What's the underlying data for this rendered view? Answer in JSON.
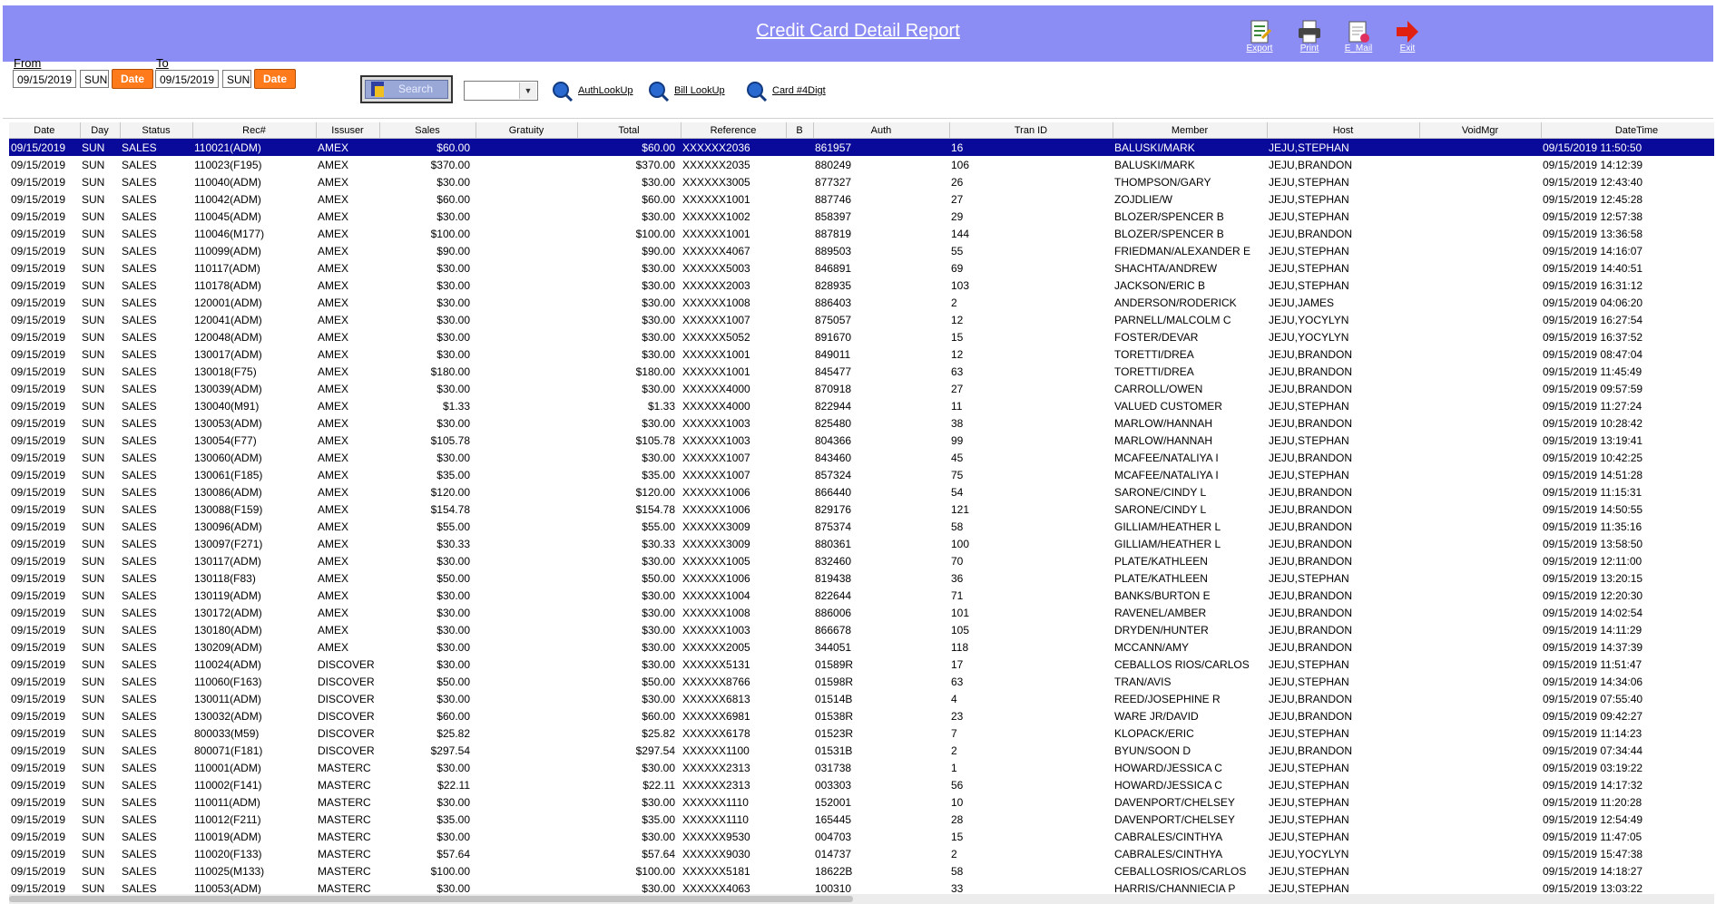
{
  "header": {
    "title": "Credit Card Detail Report",
    "buttons": {
      "export": "Export",
      "print": "Print",
      "email": "E_Mail",
      "exit": "Exit"
    }
  },
  "toolbar": {
    "from_label": "From",
    "from_date": "09/15/2019",
    "from_day": "SUN",
    "from_date_button": "Date",
    "to_label": "To",
    "to_date": "09/15/2019",
    "to_day": "SUN",
    "to_date_button": "Date",
    "search_label": "Search",
    "filter_value": "",
    "auth_lookup": "AuthLookUp",
    "bill_lookup": "Bill LookUp",
    "card_lookup": "Card #4Digt"
  },
  "columns": [
    "Date",
    "Day",
    "Status",
    "Rec#",
    "Issuser",
    "Sales",
    "Gratuity",
    "Total",
    "Reference",
    "B",
    "Auth",
    "Tran ID",
    "Member",
    "Host",
    "VoidMgr",
    "DateTime"
  ],
  "rows": [
    [
      "09/15/2019",
      "SUN",
      "SALES",
      "110021(ADM)",
      "AMEX",
      "$60.00",
      "",
      "$60.00",
      "XXXXXX2036",
      "",
      "861957",
      "16",
      "BALUSKI/MARK",
      "JEJU,STEPHAN",
      "",
      "09/15/2019 11:50:50"
    ],
    [
      "09/15/2019",
      "SUN",
      "SALES",
      "110023(F195)",
      "AMEX",
      "$370.00",
      "",
      "$370.00",
      "XXXXXX2035",
      "",
      "880249",
      "106",
      "BALUSKI/MARK",
      "JEJU,BRANDON",
      "",
      "09/15/2019 14:12:39"
    ],
    [
      "09/15/2019",
      "SUN",
      "SALES",
      "110040(ADM)",
      "AMEX",
      "$30.00",
      "",
      "$30.00",
      "XXXXXX3005",
      "",
      "877327",
      "26",
      "THOMPSON/GARY",
      "JEJU,STEPHAN",
      "",
      "09/15/2019 12:43:40"
    ],
    [
      "09/15/2019",
      "SUN",
      "SALES",
      "110042(ADM)",
      "AMEX",
      "$60.00",
      "",
      "$60.00",
      "XXXXXX1001",
      "",
      "887746",
      "27",
      "ZOJDLIE/W",
      "JEJU,STEPHAN",
      "",
      "09/15/2019 12:45:28"
    ],
    [
      "09/15/2019",
      "SUN",
      "SALES",
      "110045(ADM)",
      "AMEX",
      "$30.00",
      "",
      "$30.00",
      "XXXXXX1002",
      "",
      "858397",
      "29",
      "BLOZER/SPENCER B",
      "JEJU,STEPHAN",
      "",
      "09/15/2019 12:57:38"
    ],
    [
      "09/15/2019",
      "SUN",
      "SALES",
      "110046(M177)",
      "AMEX",
      "$100.00",
      "",
      "$100.00",
      "XXXXXX1001",
      "",
      "887819",
      "144",
      "BLOZER/SPENCER B",
      "JEJU,BRANDON",
      "",
      "09/15/2019 13:36:58"
    ],
    [
      "09/15/2019",
      "SUN",
      "SALES",
      "110099(ADM)",
      "AMEX",
      "$90.00",
      "",
      "$90.00",
      "XXXXXX4067",
      "",
      "889503",
      "55",
      "FRIEDMAN/ALEXANDER E",
      "JEJU,STEPHAN",
      "",
      "09/15/2019 14:16:07"
    ],
    [
      "09/15/2019",
      "SUN",
      "SALES",
      "110117(ADM)",
      "AMEX",
      "$30.00",
      "",
      "$30.00",
      "XXXXXX5003",
      "",
      "846891",
      "69",
      "SHACHTA/ANDREW",
      "JEJU,STEPHAN",
      "",
      "09/15/2019 14:40:51"
    ],
    [
      "09/15/2019",
      "SUN",
      "SALES",
      "110178(ADM)",
      "AMEX",
      "$30.00",
      "",
      "$30.00",
      "XXXXXX2003",
      "",
      "828935",
      "103",
      "JACKSON/ERIC B",
      "JEJU,STEPHAN",
      "",
      "09/15/2019 16:31:12"
    ],
    [
      "09/15/2019",
      "SUN",
      "SALES",
      "120001(ADM)",
      "AMEX",
      "$30.00",
      "",
      "$30.00",
      "XXXXXX1008",
      "",
      "886403",
      "2",
      "ANDERSON/RODERICK",
      "JEJU,JAMES",
      "",
      "09/15/2019 04:06:20"
    ],
    [
      "09/15/2019",
      "SUN",
      "SALES",
      "120041(ADM)",
      "AMEX",
      "$30.00",
      "",
      "$30.00",
      "XXXXXX1007",
      "",
      "875057",
      "12",
      "PARNELL/MALCOLM C",
      "JEJU,YOCYLYN",
      "",
      "09/15/2019 16:27:54"
    ],
    [
      "09/15/2019",
      "SUN",
      "SALES",
      "120048(ADM)",
      "AMEX",
      "$30.00",
      "",
      "$30.00",
      "XXXXXX5052",
      "",
      "891670",
      "15",
      "FOSTER/DEVAR",
      "JEJU,YOCYLYN",
      "",
      "09/15/2019 16:37:52"
    ],
    [
      "09/15/2019",
      "SUN",
      "SALES",
      "130017(ADM)",
      "AMEX",
      "$30.00",
      "",
      "$30.00",
      "XXXXXX1001",
      "",
      "849011",
      "12",
      "TORETTI/DREA",
      "JEJU,BRANDON",
      "",
      "09/15/2019 08:47:04"
    ],
    [
      "09/15/2019",
      "SUN",
      "SALES",
      "130018(F75)",
      "AMEX",
      "$180.00",
      "",
      "$180.00",
      "XXXXXX1001",
      "",
      "845477",
      "63",
      "TORETTI/DREA",
      "JEJU,BRANDON",
      "",
      "09/15/2019 11:45:49"
    ],
    [
      "09/15/2019",
      "SUN",
      "SALES",
      "130039(ADM)",
      "AMEX",
      "$30.00",
      "",
      "$30.00",
      "XXXXXX4000",
      "",
      "870918",
      "27",
      "CARROLL/OWEN",
      "JEJU,BRANDON",
      "",
      "09/15/2019 09:57:59"
    ],
    [
      "09/15/2019",
      "SUN",
      "SALES",
      "130040(M91)",
      "AMEX",
      "$1.33",
      "",
      "$1.33",
      "XXXXXX4000",
      "",
      "822944",
      "11",
      "VALUED CUSTOMER",
      "JEJU,STEPHAN",
      "",
      "09/15/2019 11:27:24"
    ],
    [
      "09/15/2019",
      "SUN",
      "SALES",
      "130053(ADM)",
      "AMEX",
      "$30.00",
      "",
      "$30.00",
      "XXXXXX1003",
      "",
      "825480",
      "38",
      "MARLOW/HANNAH",
      "JEJU,BRANDON",
      "",
      "09/15/2019 10:28:42"
    ],
    [
      "09/15/2019",
      "SUN",
      "SALES",
      "130054(F77)",
      "AMEX",
      "$105.78",
      "",
      "$105.78",
      "XXXXXX1003",
      "",
      "804366",
      "99",
      "MARLOW/HANNAH",
      "JEJU,STEPHAN",
      "",
      "09/15/2019 13:19:41"
    ],
    [
      "09/15/2019",
      "SUN",
      "SALES",
      "130060(ADM)",
      "AMEX",
      "$30.00",
      "",
      "$30.00",
      "XXXXXX1007",
      "",
      "843460",
      "45",
      "MCAFEE/NATALIYA I",
      "JEJU,BRANDON",
      "",
      "09/15/2019 10:42:25"
    ],
    [
      "09/15/2019",
      "SUN",
      "SALES",
      "130061(F185)",
      "AMEX",
      "$35.00",
      "",
      "$35.00",
      "XXXXXX1007",
      "",
      "857324",
      "75",
      "MCAFEE/NATALIYA I",
      "JEJU,STEPHAN",
      "",
      "09/15/2019 14:51:28"
    ],
    [
      "09/15/2019",
      "SUN",
      "SALES",
      "130086(ADM)",
      "AMEX",
      "$120.00",
      "",
      "$120.00",
      "XXXXXX1006",
      "",
      "866440",
      "54",
      "SARONE/CINDY L",
      "JEJU,BRANDON",
      "",
      "09/15/2019 11:15:31"
    ],
    [
      "09/15/2019",
      "SUN",
      "SALES",
      "130088(F159)",
      "AMEX",
      "$154.78",
      "",
      "$154.78",
      "XXXXXX1006",
      "",
      "829176",
      "121",
      "SARONE/CINDY L",
      "JEJU,BRANDON",
      "",
      "09/15/2019 14:50:55"
    ],
    [
      "09/15/2019",
      "SUN",
      "SALES",
      "130096(ADM)",
      "AMEX",
      "$55.00",
      "",
      "$55.00",
      "XXXXXX3009",
      "",
      "875374",
      "58",
      "GILLIAM/HEATHER L",
      "JEJU,BRANDON",
      "",
      "09/15/2019 11:35:16"
    ],
    [
      "09/15/2019",
      "SUN",
      "SALES",
      "130097(F271)",
      "AMEX",
      "$30.33",
      "",
      "$30.33",
      "XXXXXX3009",
      "",
      "880361",
      "100",
      "GILLIAM/HEATHER L",
      "JEJU,BRANDON",
      "",
      "09/15/2019 13:58:50"
    ],
    [
      "09/15/2019",
      "SUN",
      "SALES",
      "130117(ADM)",
      "AMEX",
      "$30.00",
      "",
      "$30.00",
      "XXXXXX1005",
      "",
      "832460",
      "70",
      "PLATE/KATHLEEN",
      "JEJU,BRANDON",
      "",
      "09/15/2019 12:11:00"
    ],
    [
      "09/15/2019",
      "SUN",
      "SALES",
      "130118(F83)",
      "AMEX",
      "$50.00",
      "",
      "$50.00",
      "XXXXXX1006",
      "",
      "819438",
      "36",
      "PLATE/KATHLEEN",
      "JEJU,STEPHAN",
      "",
      "09/15/2019 13:20:15"
    ],
    [
      "09/15/2019",
      "SUN",
      "SALES",
      "130119(ADM)",
      "AMEX",
      "$30.00",
      "",
      "$30.00",
      "XXXXXX1004",
      "",
      "822644",
      "71",
      "BANKS/BURTON E",
      "JEJU,BRANDON",
      "",
      "09/15/2019 12:20:30"
    ],
    [
      "09/15/2019",
      "SUN",
      "SALES",
      "130172(ADM)",
      "AMEX",
      "$30.00",
      "",
      "$30.00",
      "XXXXXX1008",
      "",
      "886006",
      "101",
      "RAVENEL/AMBER",
      "JEJU,BRANDON",
      "",
      "09/15/2019 14:02:54"
    ],
    [
      "09/15/2019",
      "SUN",
      "SALES",
      "130180(ADM)",
      "AMEX",
      "$30.00",
      "",
      "$30.00",
      "XXXXXX1003",
      "",
      "866678",
      "105",
      "DRYDEN/HUNTER",
      "JEJU,BRANDON",
      "",
      "09/15/2019 14:11:29"
    ],
    [
      "09/15/2019",
      "SUN",
      "SALES",
      "130209(ADM)",
      "AMEX",
      "$30.00",
      "",
      "$30.00",
      "XXXXXX2005",
      "",
      "344051",
      "118",
      "MCCANN/AMY",
      "JEJU,BRANDON",
      "",
      "09/15/2019 14:37:39"
    ],
    [
      "09/15/2019",
      "SUN",
      "SALES",
      "110024(ADM)",
      "DISCOVER",
      "$30.00",
      "",
      "$30.00",
      "XXXXXX5131",
      "",
      "01589R",
      "17",
      "CEBALLOS RIOS/CARLOS",
      "JEJU,STEPHAN",
      "",
      "09/15/2019 11:51:47"
    ],
    [
      "09/15/2019",
      "SUN",
      "SALES",
      "110060(F163)",
      "DISCOVER",
      "$50.00",
      "",
      "$50.00",
      "XXXXXX8766",
      "",
      "01598R",
      "63",
      "TRAN/AVIS",
      "JEJU,STEPHAN",
      "",
      "09/15/2019 14:34:06"
    ],
    [
      "09/15/2019",
      "SUN",
      "SALES",
      "130011(ADM)",
      "DISCOVER",
      "$30.00",
      "",
      "$30.00",
      "XXXXXX6813",
      "",
      "01514B",
      "4",
      "REED/JOSEPHINE R",
      "JEJU,BRANDON",
      "",
      "09/15/2019 07:55:40"
    ],
    [
      "09/15/2019",
      "SUN",
      "SALES",
      "130032(ADM)",
      "DISCOVER",
      "$60.00",
      "",
      "$60.00",
      "XXXXXX6981",
      "",
      "01538R",
      "23",
      "WARE JR/DAVID",
      "JEJU,BRANDON",
      "",
      "09/15/2019 09:42:27"
    ],
    [
      "09/15/2019",
      "SUN",
      "SALES",
      "800033(M59)",
      "DISCOVER",
      "$25.82",
      "",
      "$25.82",
      "XXXXXX6178",
      "",
      "01523R",
      "7",
      "KLOPACK/ERIC",
      "JEJU,STEPHAN",
      "",
      "09/15/2019 11:14:23"
    ],
    [
      "09/15/2019",
      "SUN",
      "SALES",
      "800071(F181)",
      "DISCOVER",
      "$297.54",
      "",
      "$297.54",
      "XXXXXX1100",
      "",
      "01531B",
      "2",
      "BYUN/SOON D",
      "JEJU,BRANDON",
      "",
      "09/15/2019 07:34:44"
    ],
    [
      "09/15/2019",
      "SUN",
      "SALES",
      "110001(ADM)",
      "MASTERC",
      "$30.00",
      "",
      "$30.00",
      "XXXXXX2313",
      "",
      "031738",
      "1",
      "HOWARD/JESSICA C",
      "JEJU,STEPHAN",
      "",
      "09/15/2019 03:19:22"
    ],
    [
      "09/15/2019",
      "SUN",
      "SALES",
      "110002(F141)",
      "MASTERC",
      "$22.11",
      "",
      "$22.11",
      "XXXXXX2313",
      "",
      "003303",
      "56",
      "HOWARD/JESSICA C",
      "JEJU,STEPHAN",
      "",
      "09/15/2019 14:17:32"
    ],
    [
      "09/15/2019",
      "SUN",
      "SALES",
      "110011(ADM)",
      "MASTERC",
      "$30.00",
      "",
      "$30.00",
      "XXXXXX1110",
      "",
      "152001",
      "10",
      "DAVENPORT/CHELSEY",
      "JEJU,STEPHAN",
      "",
      "09/15/2019 11:20:28"
    ],
    [
      "09/15/2019",
      "SUN",
      "SALES",
      "110012(F211)",
      "MASTERC",
      "$35.00",
      "",
      "$35.00",
      "XXXXXX1110",
      "",
      "165445",
      "28",
      "DAVENPORT/CHELSEY",
      "JEJU,STEPHAN",
      "",
      "09/15/2019 12:54:49"
    ],
    [
      "09/15/2019",
      "SUN",
      "SALES",
      "110019(ADM)",
      "MASTERC",
      "$30.00",
      "",
      "$30.00",
      "XXXXXX9530",
      "",
      "004703",
      "15",
      "CABRALES/CINTHYA",
      "JEJU,STEPHAN",
      "",
      "09/15/2019 11:47:05"
    ],
    [
      "09/15/2019",
      "SUN",
      "SALES",
      "110020(F133)",
      "MASTERC",
      "$57.64",
      "",
      "$57.64",
      "XXXXXX9030",
      "",
      "014737",
      "2",
      "CABRALES/CINTHYA",
      "JEJU,YOCYLYN",
      "",
      "09/15/2019 15:47:38"
    ],
    [
      "09/15/2019",
      "SUN",
      "SALES",
      "110025(M133)",
      "MASTERC",
      "$100.00",
      "",
      "$100.00",
      "XXXXXX5181",
      "",
      "18622B",
      "58",
      "CEBALLOSRIOS/CARLOS",
      "JEJU,STEPHAN",
      "",
      "09/15/2019 14:18:27"
    ],
    [
      "09/15/2019",
      "SUN",
      "SALES",
      "110053(ADM)",
      "MASTERC",
      "$30.00",
      "",
      "$30.00",
      "XXXXXX4063",
      "",
      "100310",
      "33",
      "HARRIS/CHANNIECIA P",
      "JEJU,STEPHAN",
      "",
      "09/15/2019 13:03:22"
    ]
  ],
  "selected_row": 0,
  "colors": {
    "header_bg": "#8c8cf5",
    "selected_row": "#0a0a9a",
    "date_button": "#ff7a1a"
  }
}
